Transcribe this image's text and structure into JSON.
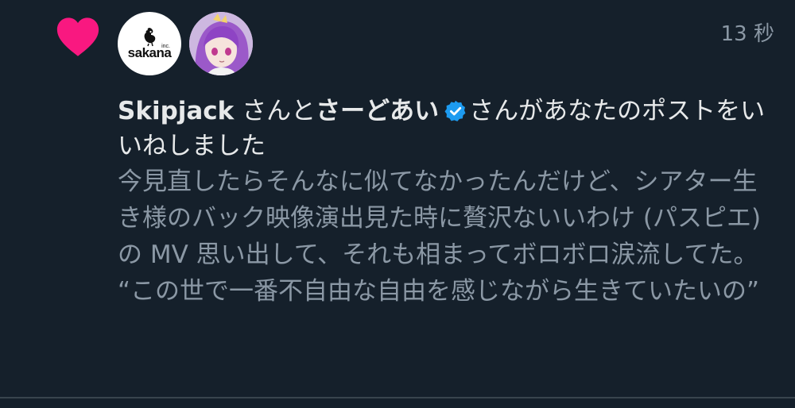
{
  "notification": {
    "timestamp": "13 秒",
    "actor1_name": "Skipjack",
    "connector": " さんと",
    "actor2_name": "さーどあい",
    "action_text": "さんがあなたのポストをいいねしました",
    "avatar1_logo_text": "sakana",
    "avatar1_logo_sub": "inc.",
    "post_line1": "今見直したらそんなに似てなかったんだけど、シアター生き様のバック映像演出見た時に贅沢ないいわけ (パスピエ) の MV 思い出して、それも相まってボロボロ涙流してた。",
    "post_line2": "“この世で一番不自由な自由を感じながら生きていたいの”"
  },
  "colors": {
    "background": "#15202b",
    "heart": "#f91880",
    "verified": "#1d9bf0",
    "primary_text": "#e7e9ea",
    "secondary_text": "#8b98a5"
  },
  "icons": {
    "like": "heart-icon",
    "verified": "verified-badge-icon"
  }
}
